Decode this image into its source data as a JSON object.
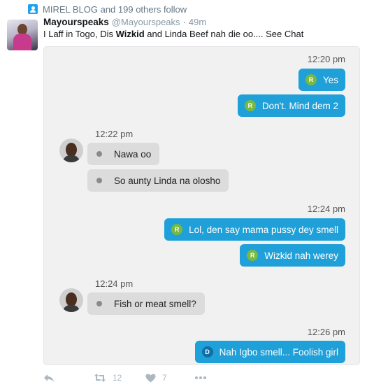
{
  "social_context": {
    "text": "MIREL BLOG and 199 others follow",
    "icon": "person-follow-icon"
  },
  "tweet": {
    "author_name": "Mayourspeaks",
    "author_handle": "@Mayourspeaks",
    "separator": "·",
    "time": "49m",
    "text_before": "I Laff in Togo, Dis ",
    "text_bold": "Wizkid",
    "text_after": " and Linda Beef nah die oo.... See Chat"
  },
  "chat": {
    "outgoing_badge": "R",
    "messages": {
      "ts1": "12:20 pm",
      "m1": "Yes",
      "m2": "Don't. Mind dem 2",
      "ts2": "12:22 pm",
      "m3": "Nawa oo",
      "m4": "So aunty Linda na olosho",
      "ts3": "12:24 pm",
      "m5": "Lol, den say mama pussy dey smell",
      "m6": "Wizkid nah werey",
      "ts4": "12:24 pm",
      "m7": "Fish or meat smell?",
      "ts5": "12:26 pm",
      "m8": "Nah Igbo smell... Foolish girl",
      "m8_badge": "D"
    },
    "colors": {
      "outgoing": "#1fa0d8",
      "incoming": "#dcdcdc",
      "badge_green": "#7ab842",
      "badge_blue": "#0f6fa8"
    }
  },
  "actions": {
    "reply_icon": "reply-icon",
    "retweet_icon": "retweet-icon",
    "retweet_count": "12",
    "like_icon": "heart-icon",
    "like_count": "7",
    "more_icon": "more-icon"
  }
}
